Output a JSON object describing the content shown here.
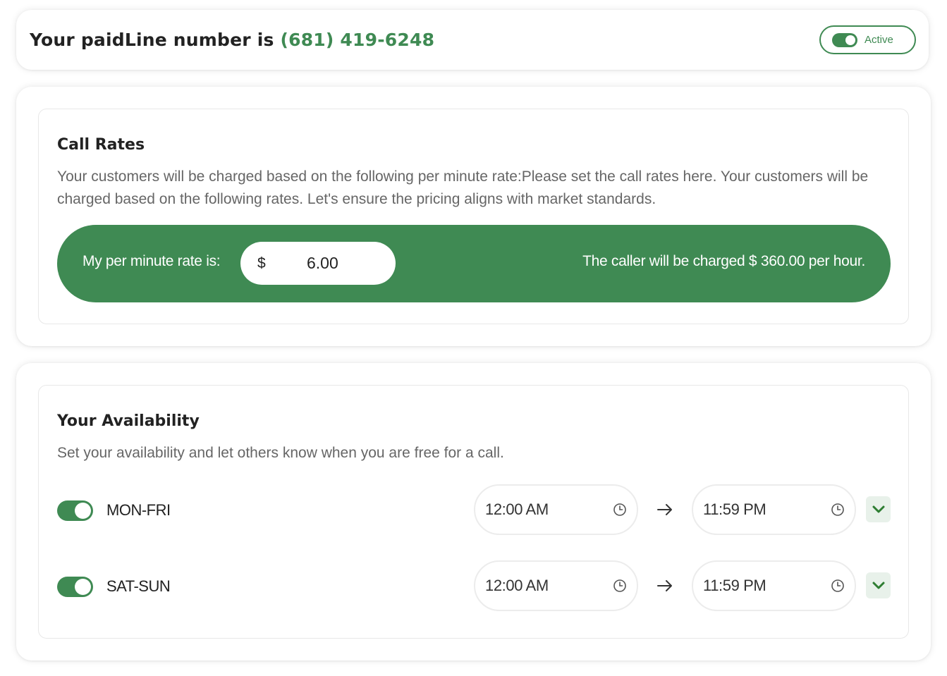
{
  "header": {
    "title_prefix": "Your paidLine number is ",
    "phone_number": "(681) 419-6248",
    "status_label": "Active",
    "status_on": true
  },
  "call_rates": {
    "title": "Call Rates",
    "description": "Your customers will be charged based on the following per minute rate:Please set the call rates here. Your customers will be charged based on the following rates. Let's ensure the pricing aligns with market standards.",
    "rate_label": "My per minute rate is:",
    "currency_symbol": "$",
    "rate_value": "6.00",
    "charge_text": "The caller will be charged $ 360.00 per hour."
  },
  "availability": {
    "title": "Your Availability",
    "description": "Set your availability and let others know when you are free for a call.",
    "rows": [
      {
        "label": "MON-FRI",
        "enabled": true,
        "start": "12:00 AM",
        "end": "11:59 PM"
      },
      {
        "label": "SAT-SUN",
        "enabled": true,
        "start": "12:00 AM",
        "end": "11:59 PM"
      }
    ]
  },
  "icons": {
    "clock": "clock-icon",
    "arrow": "arrow-right-icon",
    "expand": "chevron-down-icon"
  },
  "colors": {
    "brand_green": "#3f8a53",
    "expand_bg": "#e8f1ea"
  }
}
